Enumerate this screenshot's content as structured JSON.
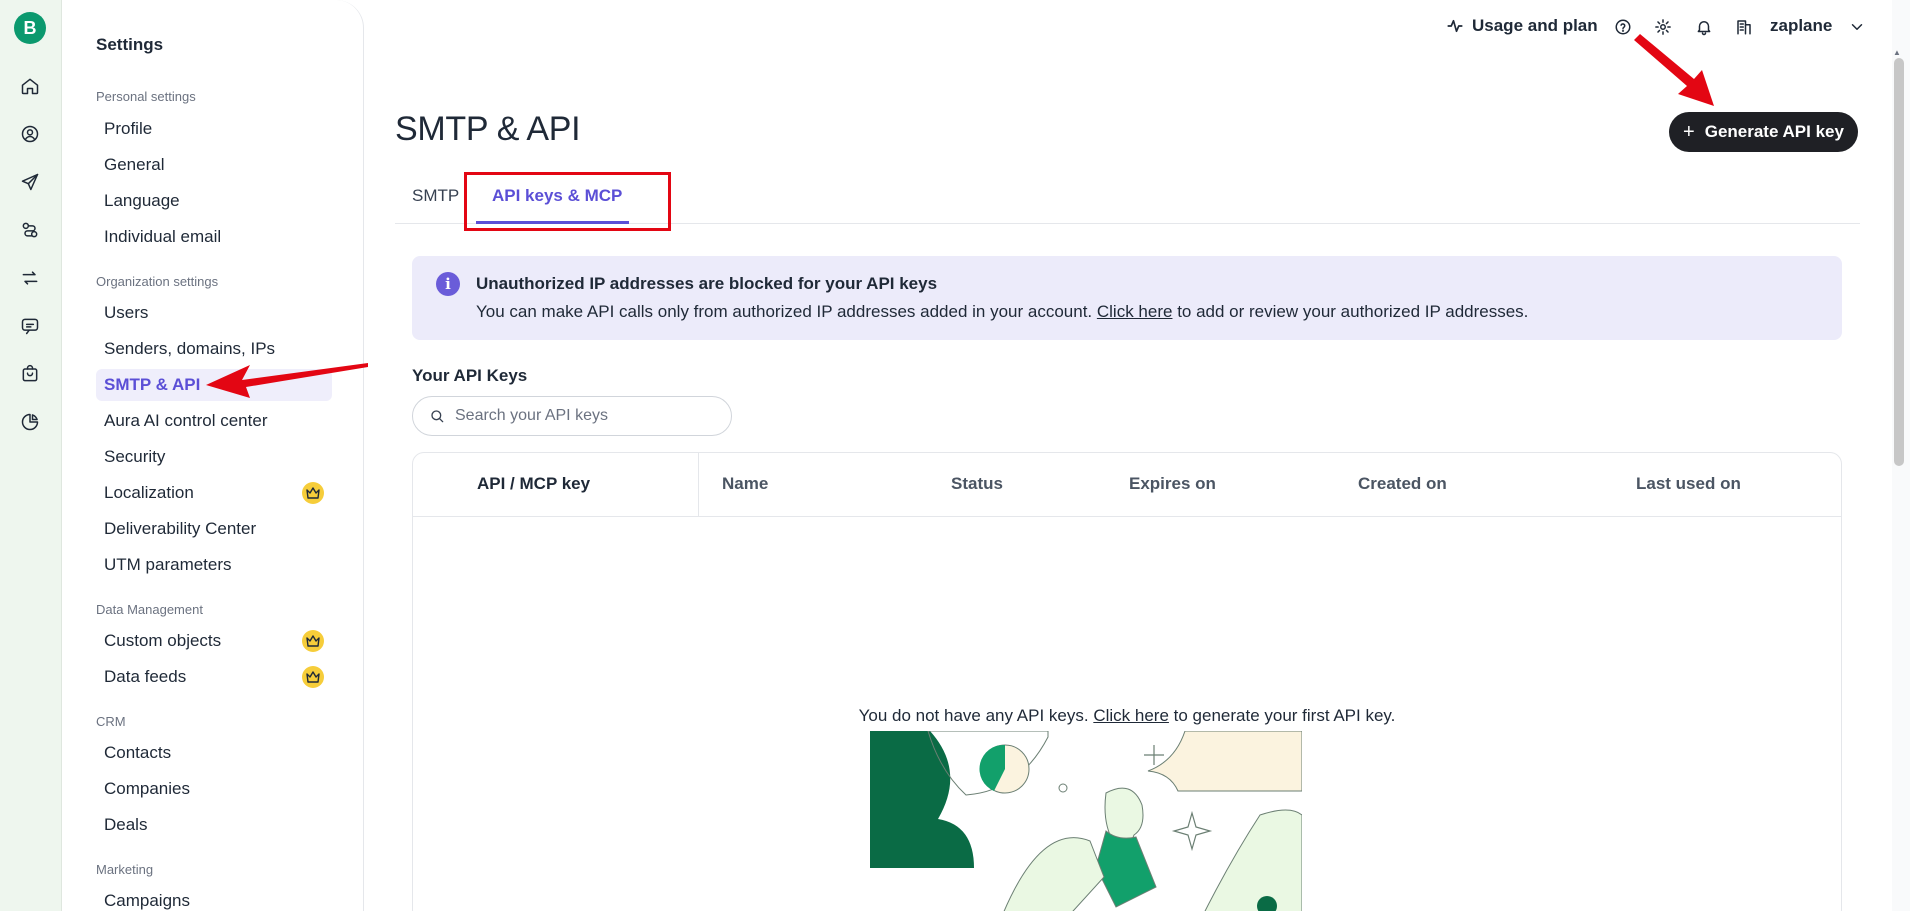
{
  "rail": {
    "logo": "B",
    "icons": [
      "home-icon",
      "contacts-icon",
      "send-icon",
      "automation-icon",
      "transfer-icon",
      "chat-icon",
      "shop-icon",
      "reports-icon"
    ]
  },
  "sidebar": {
    "title": "Settings",
    "groups": {
      "personal": "Personal settings",
      "organization": "Organization settings",
      "data": "Data Management",
      "crm": "CRM",
      "marketing": "Marketing"
    },
    "items": {
      "profile": "Profile",
      "general": "General",
      "language": "Language",
      "individual_email": "Individual email",
      "users": "Users",
      "senders": "Senders, domains, IPs",
      "smtp_api": "SMTP & API",
      "aura": "Aura AI control center",
      "security": "Security",
      "localization": "Localization",
      "deliverability": "Deliverability Center",
      "utm": "UTM parameters",
      "custom_objects": "Custom objects",
      "data_feeds": "Data feeds",
      "contacts": "Contacts",
      "companies": "Companies",
      "deals": "Deals",
      "campaigns": "Campaigns"
    }
  },
  "topbar": {
    "usage": "Usage and plan",
    "org": "zaplane"
  },
  "main": {
    "title": "SMTP & API",
    "generate_button": "Generate API key",
    "tabs": {
      "smtp": "SMTP",
      "api": "API keys & MCP"
    },
    "banner": {
      "title": "Unauthorized IP addresses are blocked for your API keys",
      "text_before": "You can make API calls only from authorized IP addresses added in your account. ",
      "link": "Click here",
      "text_after": " to add or review your authorized IP addresses."
    },
    "keys_title": "Your API Keys",
    "search_placeholder": "Search your API keys",
    "columns": [
      "API / MCP key",
      "Name",
      "Status",
      "Expires on",
      "Created on",
      "Last used on"
    ],
    "empty": {
      "before": "You do not have any API keys. ",
      "link": "Click here",
      "after": " to generate your first API key."
    }
  },
  "colors": {
    "accent": "#5b4fd6",
    "brand_green": "#0b996e",
    "annotation_red": "#e30613",
    "premium_gold": "#f6cd3a"
  }
}
